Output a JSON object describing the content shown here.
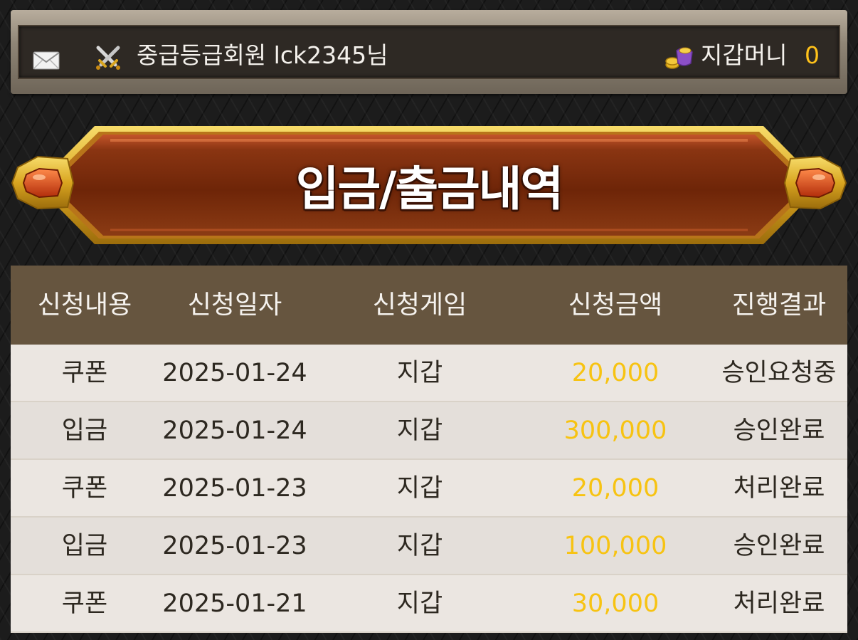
{
  "header": {
    "member_grade": "중급등급회원",
    "username": "lck2345",
    "suffix": "님",
    "wallet_label": "지갑머니",
    "wallet_amount": "0",
    "icons": [
      "mail-icon",
      "crossed-swords-icon",
      "wallet-coins-icon"
    ]
  },
  "banner": {
    "title": "입금/출금내역"
  },
  "table": {
    "columns": [
      "신청내용",
      "신청일자",
      "신청게임",
      "신청금액",
      "진행결과"
    ],
    "rows": [
      {
        "type": "쿠폰",
        "date": "2025-01-24",
        "game": "지갑",
        "amount": "20,000",
        "status": "승인요청중"
      },
      {
        "type": "입금",
        "date": "2025-01-24",
        "game": "지갑",
        "amount": "300,000",
        "status": "승인완료"
      },
      {
        "type": "쿠폰",
        "date": "2025-01-23",
        "game": "지갑",
        "amount": "20,000",
        "status": "처리완료"
      },
      {
        "type": "입금",
        "date": "2025-01-23",
        "game": "지갑",
        "amount": "100,000",
        "status": "승인완료"
      },
      {
        "type": "쿠폰",
        "date": "2025-01-21",
        "game": "지갑",
        "amount": "30,000",
        "status": "처리완료"
      }
    ]
  },
  "colors": {
    "amount": "#f7c312",
    "wallet_amount": "#ffc21a",
    "table_header": "#66553f",
    "banner": "#7a2e0e",
    "banner_frame": "#d9a520"
  }
}
